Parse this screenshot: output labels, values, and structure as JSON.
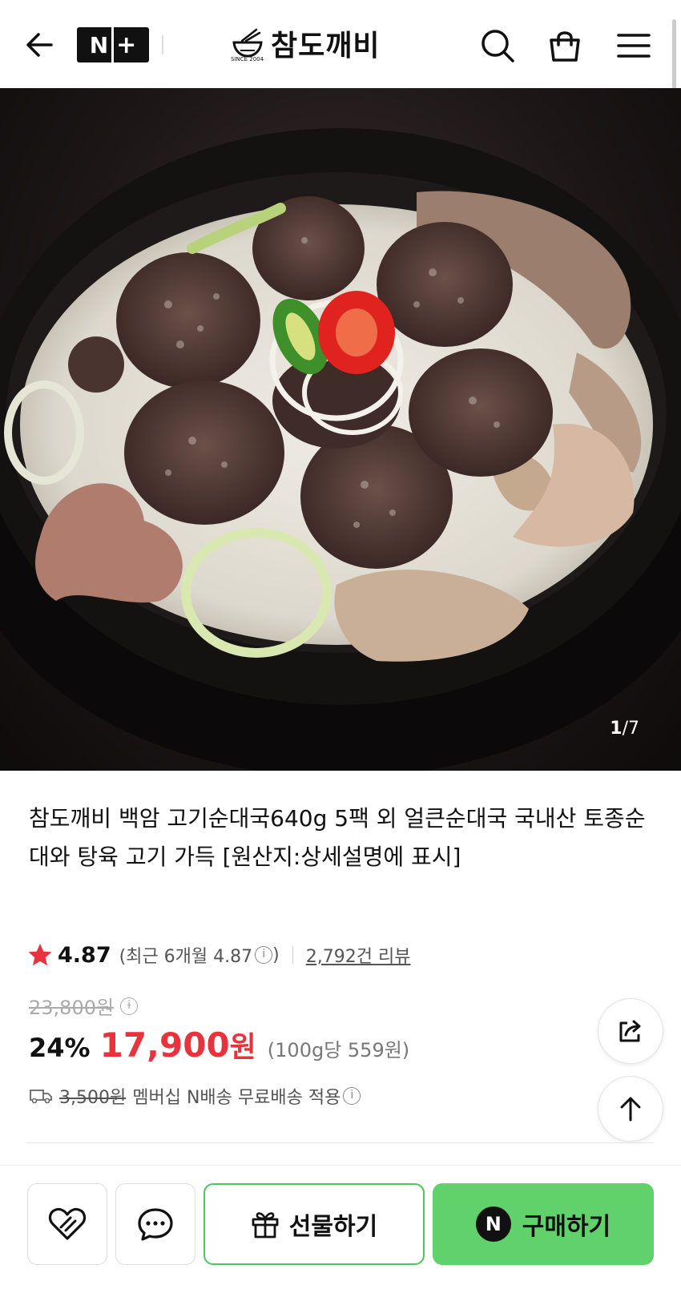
{
  "header": {
    "nplus_left": "N",
    "nplus_right": "+",
    "brand_name": "참도깨비",
    "brand_since": "SINCE 2004"
  },
  "hero": {
    "image_counter_current": "1",
    "image_counter_total": "/7"
  },
  "product": {
    "title": "참도깨비 백암 고기순대국640g 5팩 외 얼큰순대국 국내산 토종순대와 탕육 고기 가득 [원산지:상세설명에 표시]",
    "rating": "4.87",
    "recent_rating_prefix": "(최근 6개월 4.87",
    "recent_rating_suffix": ")",
    "review_count": "2,792건 리뷰",
    "original_price": "23,800원",
    "discount_rate": "24%",
    "sale_price_number": "17,900",
    "sale_price_unit": "원",
    "unit_price": "(100g당 559원)",
    "shipping_original": "3,500원",
    "shipping_text": "멤버십 N배송 무료배송 적용"
  },
  "bottom_bar": {
    "gift_label": "선물하기",
    "buy_label": "구매하기",
    "buy_badge": "N"
  },
  "colors": {
    "sale_red": "#e8323c",
    "buy_green": "#60d16b",
    "gift_border": "#4fc461",
    "star": "#e8323c"
  }
}
